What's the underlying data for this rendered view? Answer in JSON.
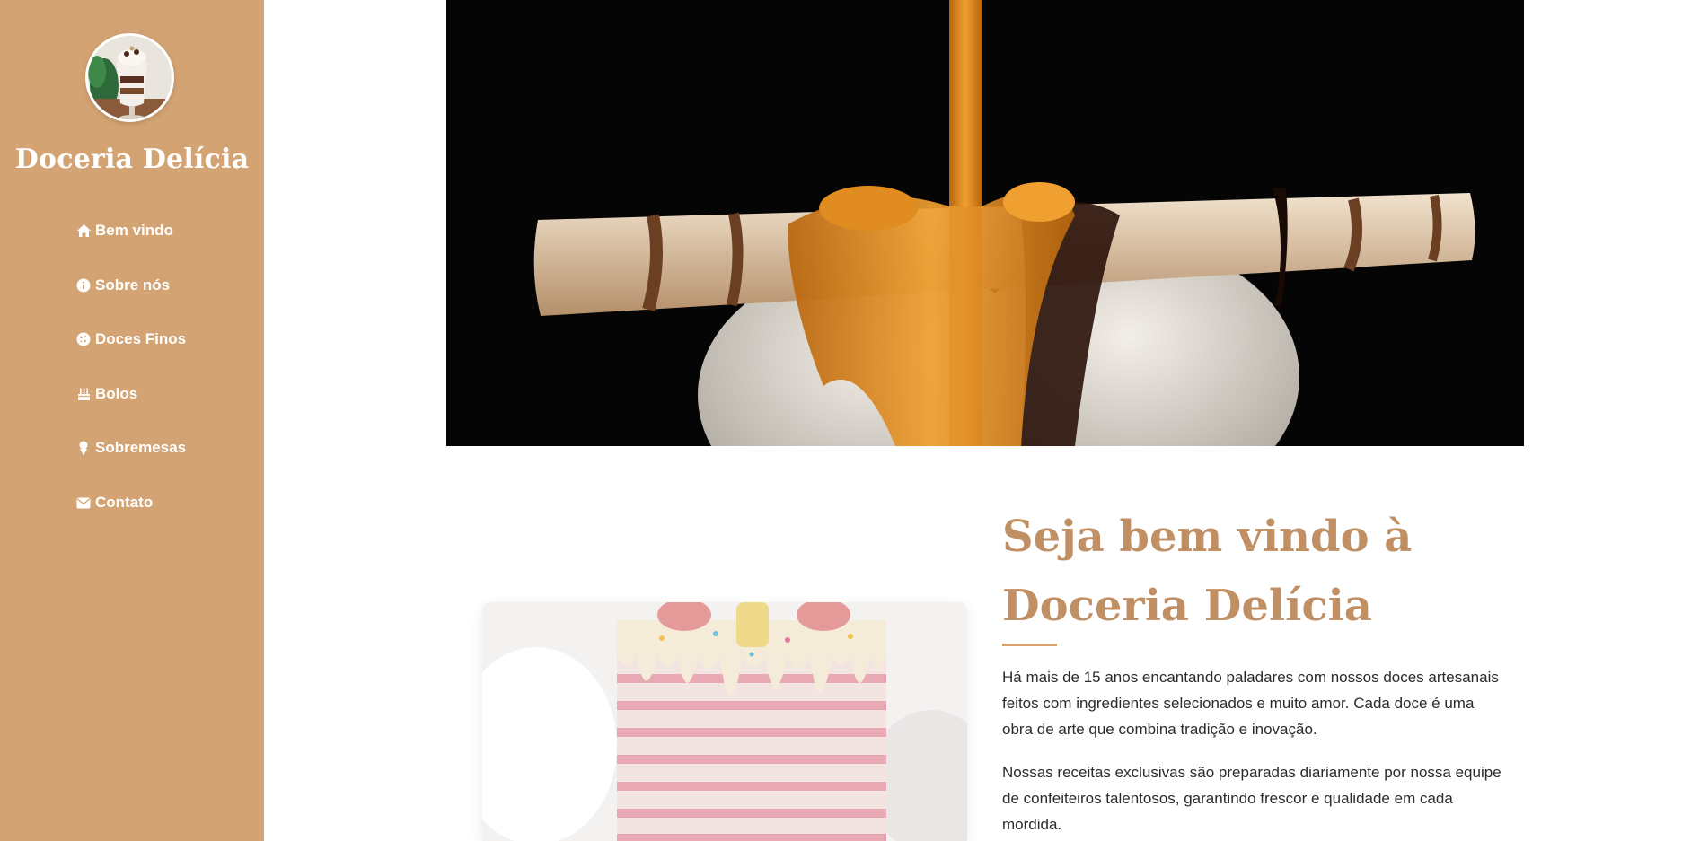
{
  "sidebar": {
    "brand": "Doceria Delícia",
    "items": [
      {
        "label": "Bem vindo",
        "icon": "home-icon"
      },
      {
        "label": "Sobre nós",
        "icon": "info-icon"
      },
      {
        "label": "Doces Finos",
        "icon": "cookie-icon"
      },
      {
        "label": "Bolos",
        "icon": "cake-icon"
      },
      {
        "label": "Sobremesas",
        "icon": "ice-cream-icon"
      },
      {
        "label": "Contato",
        "icon": "envelope-icon"
      }
    ]
  },
  "welcome": {
    "title_line1": "Seja bem vindo à",
    "title_line2": "Doceria Delícia",
    "paragraph1": "Há mais de 15 anos encantando paladares com nossos doces artesanais feitos com ingredientes selecionados e muito amor. Cada doce é uma obra de arte que combina tradição e inovação.",
    "paragraph2": "Nossas receitas exclusivas são preparadas diariamente por nossa equipe de confeiteiros talentosos, garantindo frescor e qualidade em cada mordida."
  },
  "colors": {
    "sidebar": "#d4a373",
    "heading": "#c08f63",
    "text": "#2b2b2b"
  }
}
